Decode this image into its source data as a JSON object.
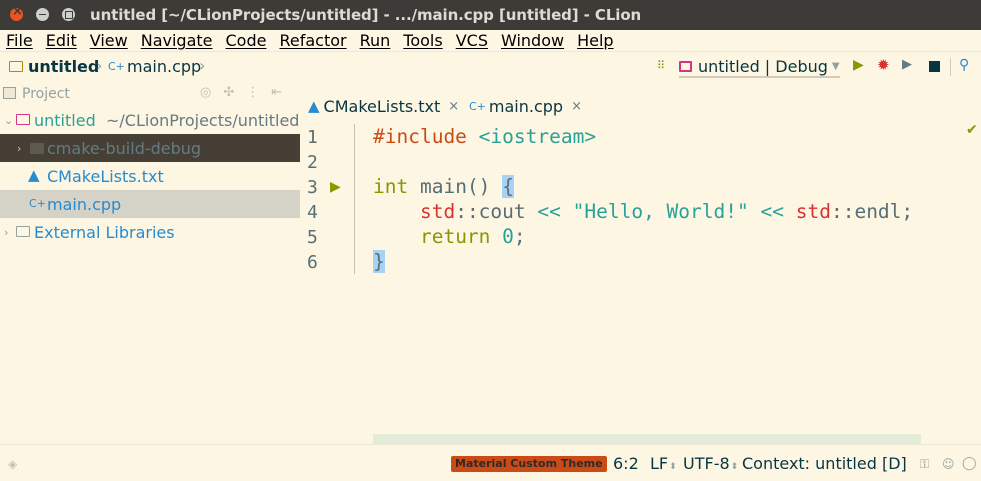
{
  "window": {
    "title": "untitled [~/CLionProjects/untitled] - .../main.cpp [untitled] - CLion"
  },
  "menu": [
    "File",
    "Edit",
    "View",
    "Navigate",
    "Code",
    "Refactor",
    "Run",
    "Tools",
    "VCS",
    "Window",
    "Help"
  ],
  "breadcrumb": {
    "project": "untitled",
    "file": "main.cpp"
  },
  "toolbar": {
    "run_config": "untitled | Debug"
  },
  "project_panel": {
    "title": "Project",
    "root": {
      "name": "untitled",
      "path": "~/CLionProjects/untitled"
    },
    "items": [
      {
        "label": "cmake-build-debug"
      },
      {
        "label": "CMakeLists.txt"
      },
      {
        "label": "main.cpp"
      },
      {
        "label": "External Libraries"
      }
    ]
  },
  "tabs": [
    {
      "label": "CMakeLists.txt",
      "close": "×"
    },
    {
      "label": "main.cpp",
      "close": "×"
    }
  ],
  "editor": {
    "line_numbers": [
      "1",
      "2",
      "3",
      "4",
      "5",
      "6"
    ],
    "code": {
      "l1_pre": "#include",
      "l1_inc": "<iostream>",
      "l3_type": "int",
      "l3_fn": "main()",
      "l3_brace": "{",
      "l4_ns1": "std",
      "l4_cout": "::cout",
      "l4_op1": "<<",
      "l4_str": "\"Hello, World!\"",
      "l4_op2": "<<",
      "l4_ns2": "std",
      "l4_endl": "::endl;",
      "l5_ret": "return",
      "l5_num": "0",
      "l5_semi": ";",
      "l6_brace": "}"
    }
  },
  "status": {
    "theme": "Material Custom Theme",
    "position": "6:2",
    "line_sep": "LF",
    "encoding": "UTF-8",
    "context": "Context: untitled [D]"
  }
}
